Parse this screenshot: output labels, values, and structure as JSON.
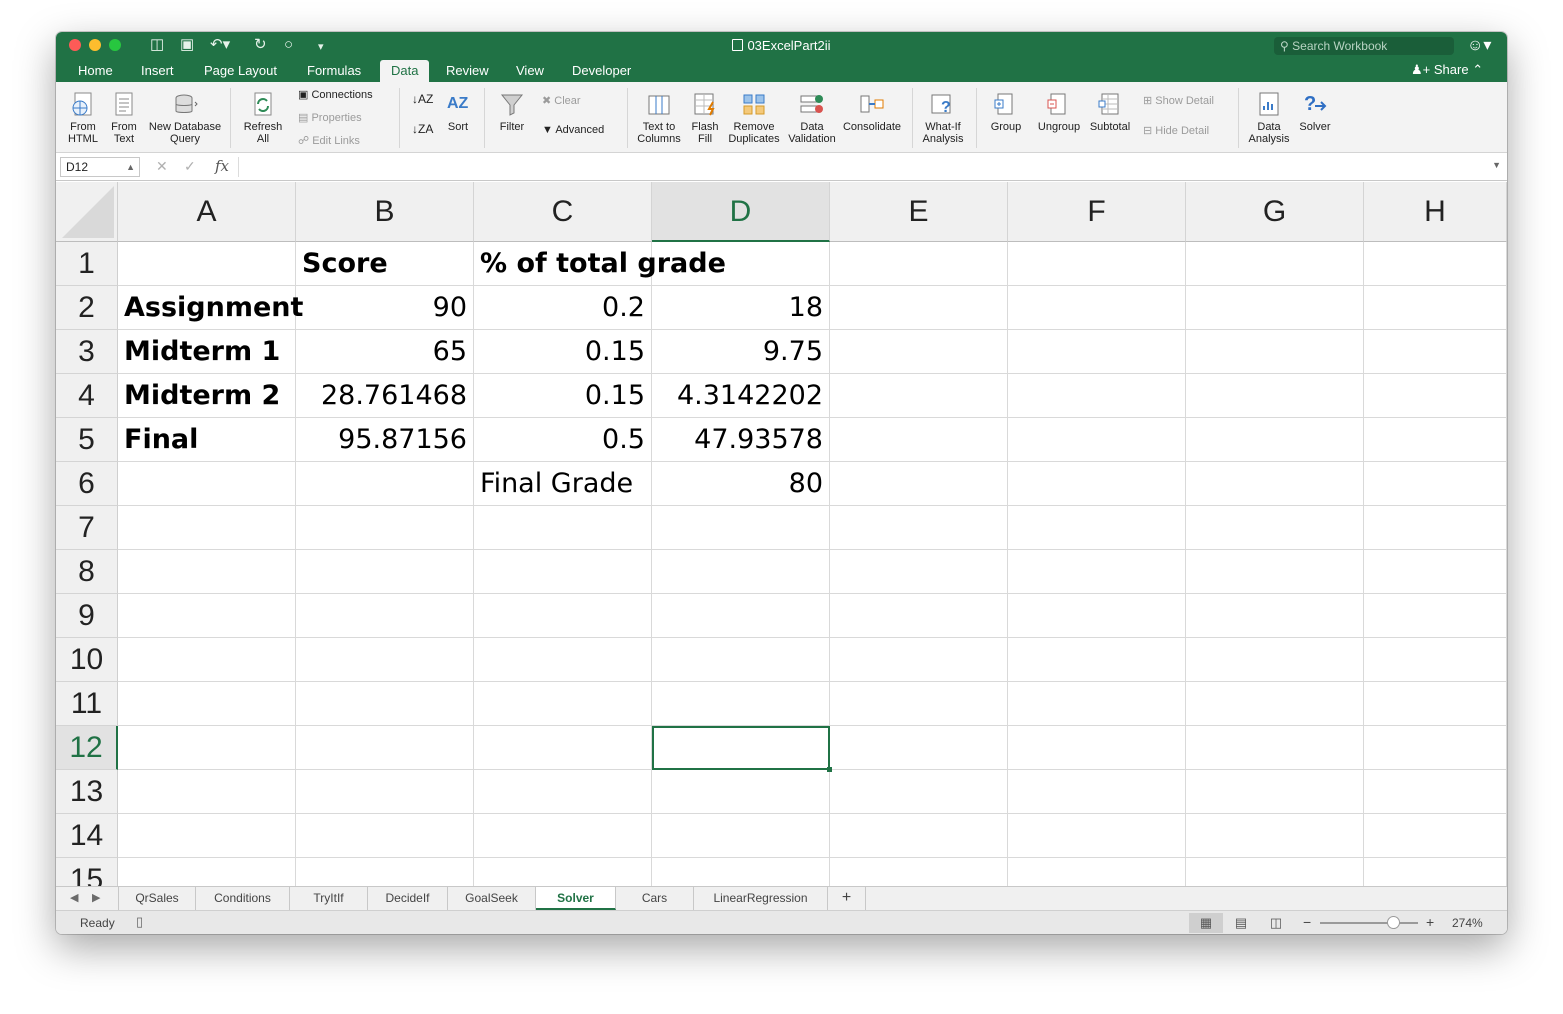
{
  "window": {
    "title": "03ExcelPart2ii",
    "search_placeholder": "Search Workbook"
  },
  "ribbon_tabs": [
    "Home",
    "Insert",
    "Page Layout",
    "Formulas",
    "Data",
    "Review",
    "View",
    "Developer"
  ],
  "active_tab": "Data",
  "share_label": "Share",
  "ribbon": {
    "from_html": [
      "From",
      "HTML"
    ],
    "from_text": [
      "From",
      "Text"
    ],
    "new_db_query": [
      "New Database",
      "Query"
    ],
    "refresh_all": [
      "Refresh",
      "All"
    ],
    "connections": "Connections",
    "properties": "Properties",
    "edit_links": "Edit Links",
    "sort": "Sort",
    "filter": "Filter",
    "clear": "Clear",
    "advanced": "Advanced",
    "text_to_columns": [
      "Text to",
      "Columns"
    ],
    "flash_fill": [
      "Flash",
      "Fill"
    ],
    "remove_duplicates": [
      "Remove",
      "Duplicates"
    ],
    "data_validation": [
      "Data",
      "Validation"
    ],
    "consolidate": "Consolidate",
    "what_if": [
      "What-If",
      "Analysis"
    ],
    "group": "Group",
    "ungroup": "Ungroup",
    "subtotal": "Subtotal",
    "show_detail": "Show Detail",
    "hide_detail": "Hide Detail",
    "data_analysis": [
      "Data",
      "Analysis"
    ],
    "solver": "Solver"
  },
  "formula_bar": {
    "name_box": "D12",
    "fx": "fx",
    "formula": ""
  },
  "columns": [
    "A",
    "B",
    "C",
    "D",
    "E",
    "F",
    "G",
    "H"
  ],
  "selected_column": "D",
  "rows": [
    "1",
    "2",
    "3",
    "4",
    "5",
    "6",
    "7",
    "8",
    "9",
    "10",
    "11",
    "12",
    "13",
    "14",
    "15"
  ],
  "selected_row": "12",
  "cells": {
    "B1": "Score",
    "C1": "% of total grade",
    "A2": "Assignment",
    "B2": "90",
    "C2": "0.2",
    "D2": "18",
    "A3": "Midterm 1",
    "B3": "65",
    "C3": "0.15",
    "D3": "9.75",
    "A4": "Midterm 2",
    "B4": "28.761468",
    "C4": "0.15",
    "D4": "4.3142202",
    "A5": "Final",
    "B5": "95.87156",
    "C5": "0.5",
    "D5": "47.93578",
    "C6": "Final Grade",
    "D6": "80"
  },
  "sheet_tabs": [
    "QrSales",
    "Conditions",
    "TryItIf",
    "DecideIf",
    "GoalSeek",
    "Solver",
    "Cars",
    "LinearRegression"
  ],
  "active_sheet": "Solver",
  "status": {
    "ready": "Ready",
    "zoom": "274%"
  },
  "colors": {
    "excel_green": "#207245",
    "gridline": "#d9d9d9"
  }
}
